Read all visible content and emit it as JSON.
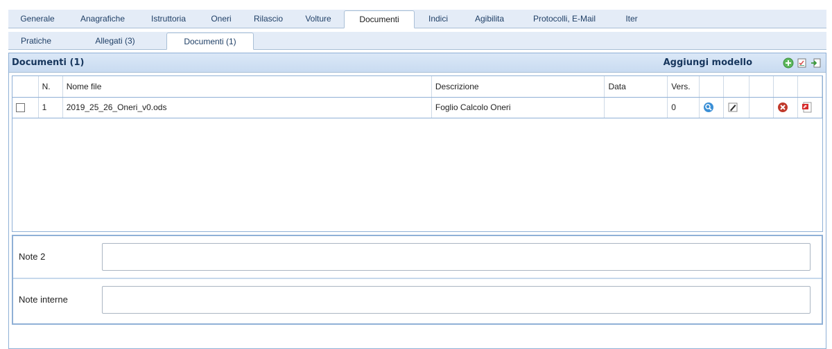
{
  "top_tabs": [
    {
      "label": "Generale",
      "active": false
    },
    {
      "label": "Anagrafiche",
      "active": false
    },
    {
      "label": "Istruttoria",
      "active": false
    },
    {
      "label": "Oneri",
      "active": false
    },
    {
      "label": "Rilascio",
      "active": false
    },
    {
      "label": "Volture",
      "active": false
    },
    {
      "label": "Documenti",
      "active": true
    },
    {
      "label": "Indici",
      "active": false
    },
    {
      "label": "Agibilita",
      "active": false
    },
    {
      "label": "Protocolli, E-Mail",
      "active": false
    },
    {
      "label": "Iter",
      "active": false
    }
  ],
  "sub_tabs": [
    {
      "label": "Pratiche",
      "active": false
    },
    {
      "label": "Allegati (3)",
      "active": false
    },
    {
      "label": "Documenti (1)",
      "active": true
    }
  ],
  "panel": {
    "title": "Documenti (1)",
    "action_label": "Aggiungi modello",
    "header_icons": [
      "add-icon",
      "checklist-icon",
      "export-icon"
    ]
  },
  "table": {
    "columns": [
      "",
      "N.",
      "Nome file",
      "Descrizione",
      "Data",
      "Vers.",
      "",
      "",
      "",
      "",
      ""
    ],
    "rows": [
      {
        "checked": false,
        "n": "1",
        "file": "2019_25_26_Oneri_v0.ods",
        "descrizione": "Foglio Calcolo Oneri",
        "data": "",
        "vers": "0",
        "actions": [
          "view-icon",
          "edit-icon",
          "",
          "delete-icon",
          "pdf-icon"
        ]
      }
    ]
  },
  "notes": {
    "note2_label": "Note 2",
    "note2_value": "",
    "interne_label": "Note interne",
    "interne_value": ""
  },
  "colors": {
    "accent": "#8fb0d6",
    "header_bg": "#c9dbf1",
    "title": "#17365d",
    "delete": "#c0392b",
    "view": "#3a8fd6"
  }
}
